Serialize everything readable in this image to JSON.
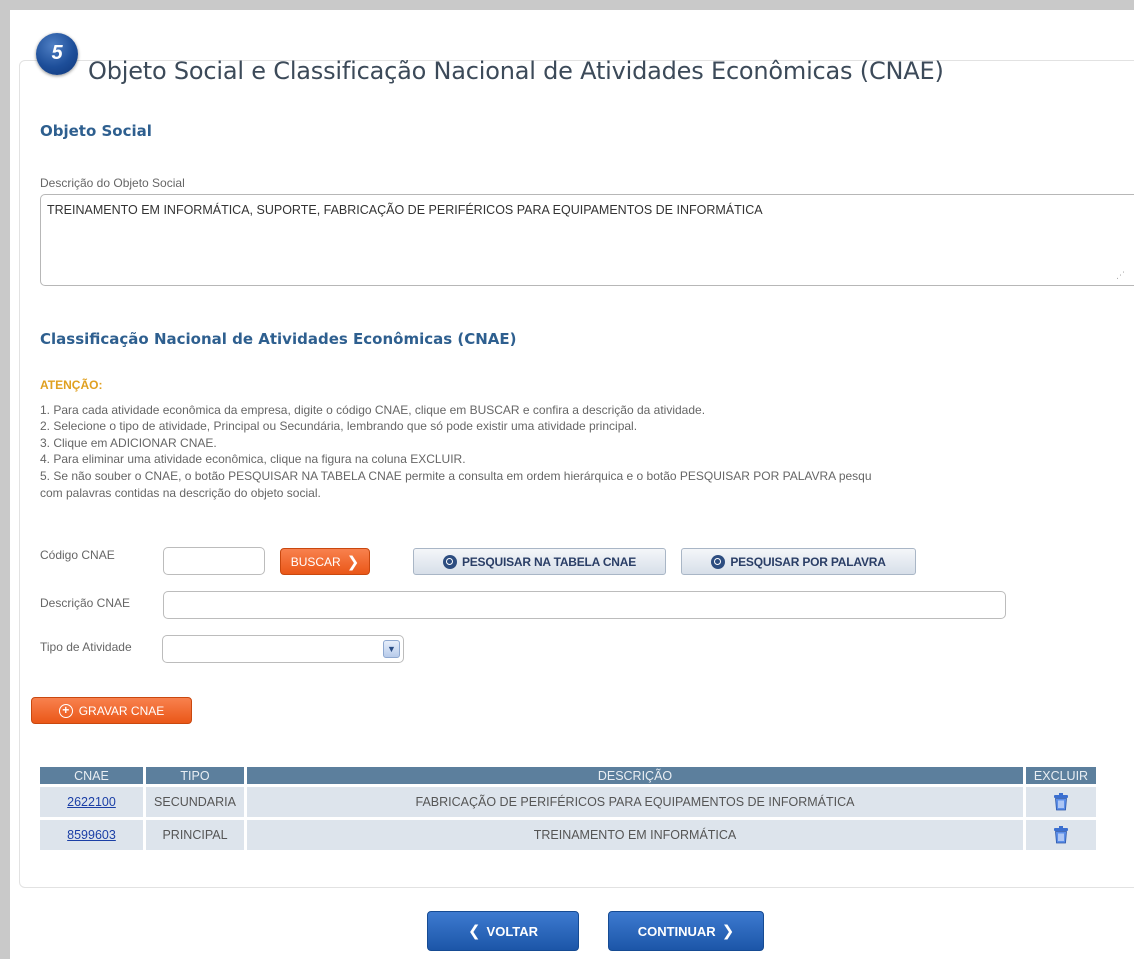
{
  "header": {
    "step_number": "5",
    "title": "Objeto Social e Classificação Nacional de Atividades Econômicas (CNAE)"
  },
  "objeto_social": {
    "section_title": "Objeto Social",
    "description_label": "Descrição do Objeto Social",
    "description_value": "TREINAMENTO EM INFORMÁTICA, SUPORTE, FABRICAÇÃO DE PERIFÉRICOS PARA EQUIPAMENTOS DE INFORMÁTICA"
  },
  "cnae": {
    "section_title": "Classificação Nacional de Atividades Econômicas (CNAE)",
    "attention_label": "ATENÇÃO:",
    "instructions": [
      "1. Para cada atividade econômica da empresa, digite o código CNAE, clique em BUSCAR e confira a descrição da atividade.",
      "2. Selecione o tipo de atividade, Principal ou Secundária, lembrando que só pode existir uma atividade principal.",
      "3. Clique em ADICIONAR CNAE.",
      "4. Para eliminar uma atividade econômica, clique na figura na coluna EXCLUIR.",
      "5. Se não souber o CNAE, o botão PESQUISAR NA TABELA CNAE permite a consulta em ordem hierárquica e o botão PESQUISAR POR PALAVRA pesqu",
      "com palavras contidas na descrição do objeto social."
    ],
    "form": {
      "codigo_label": "Código CNAE",
      "codigo_value": "",
      "buscar_label": "BUSCAR",
      "pesquisar_tabela_label": "PESQUISAR NA TABELA CNAE",
      "pesquisar_palavra_label": "PESQUISAR POR PALAVRA",
      "descricao_label": "Descrição CNAE",
      "descricao_value": "",
      "tipo_label": "Tipo de Atividade",
      "tipo_value": "",
      "gravar_label": "GRAVAR CNAE"
    },
    "table": {
      "headers": [
        "CNAE",
        "TIPO",
        "DESCRIÇÃO",
        "EXCLUIR"
      ],
      "rows": [
        {
          "cnae": "2622100",
          "tipo": "SECUNDARIA",
          "descricao": "FABRICAÇÃO DE PERIFÉRICOS PARA EQUIPAMENTOS DE INFORMÁTICA",
          "excluir_icon": "trash-icon"
        },
        {
          "cnae": "8599603",
          "tipo": "PRINCIPAL",
          "descricao": "TREINAMENTO EM INFORMÁTICA",
          "excluir_icon": "trash-icon"
        }
      ]
    }
  },
  "nav": {
    "voltar_label": "VOLTAR",
    "continuar_label": "CONTINUAR"
  },
  "colors": {
    "step_badge": "#1d4e99",
    "section_title": "#2e5f8f",
    "attention": "#e0a020",
    "orange_button": "#ea5718",
    "blue_button": "#1c56a8",
    "table_header": "#5c7f9d",
    "table_row": "#dde4ec"
  }
}
